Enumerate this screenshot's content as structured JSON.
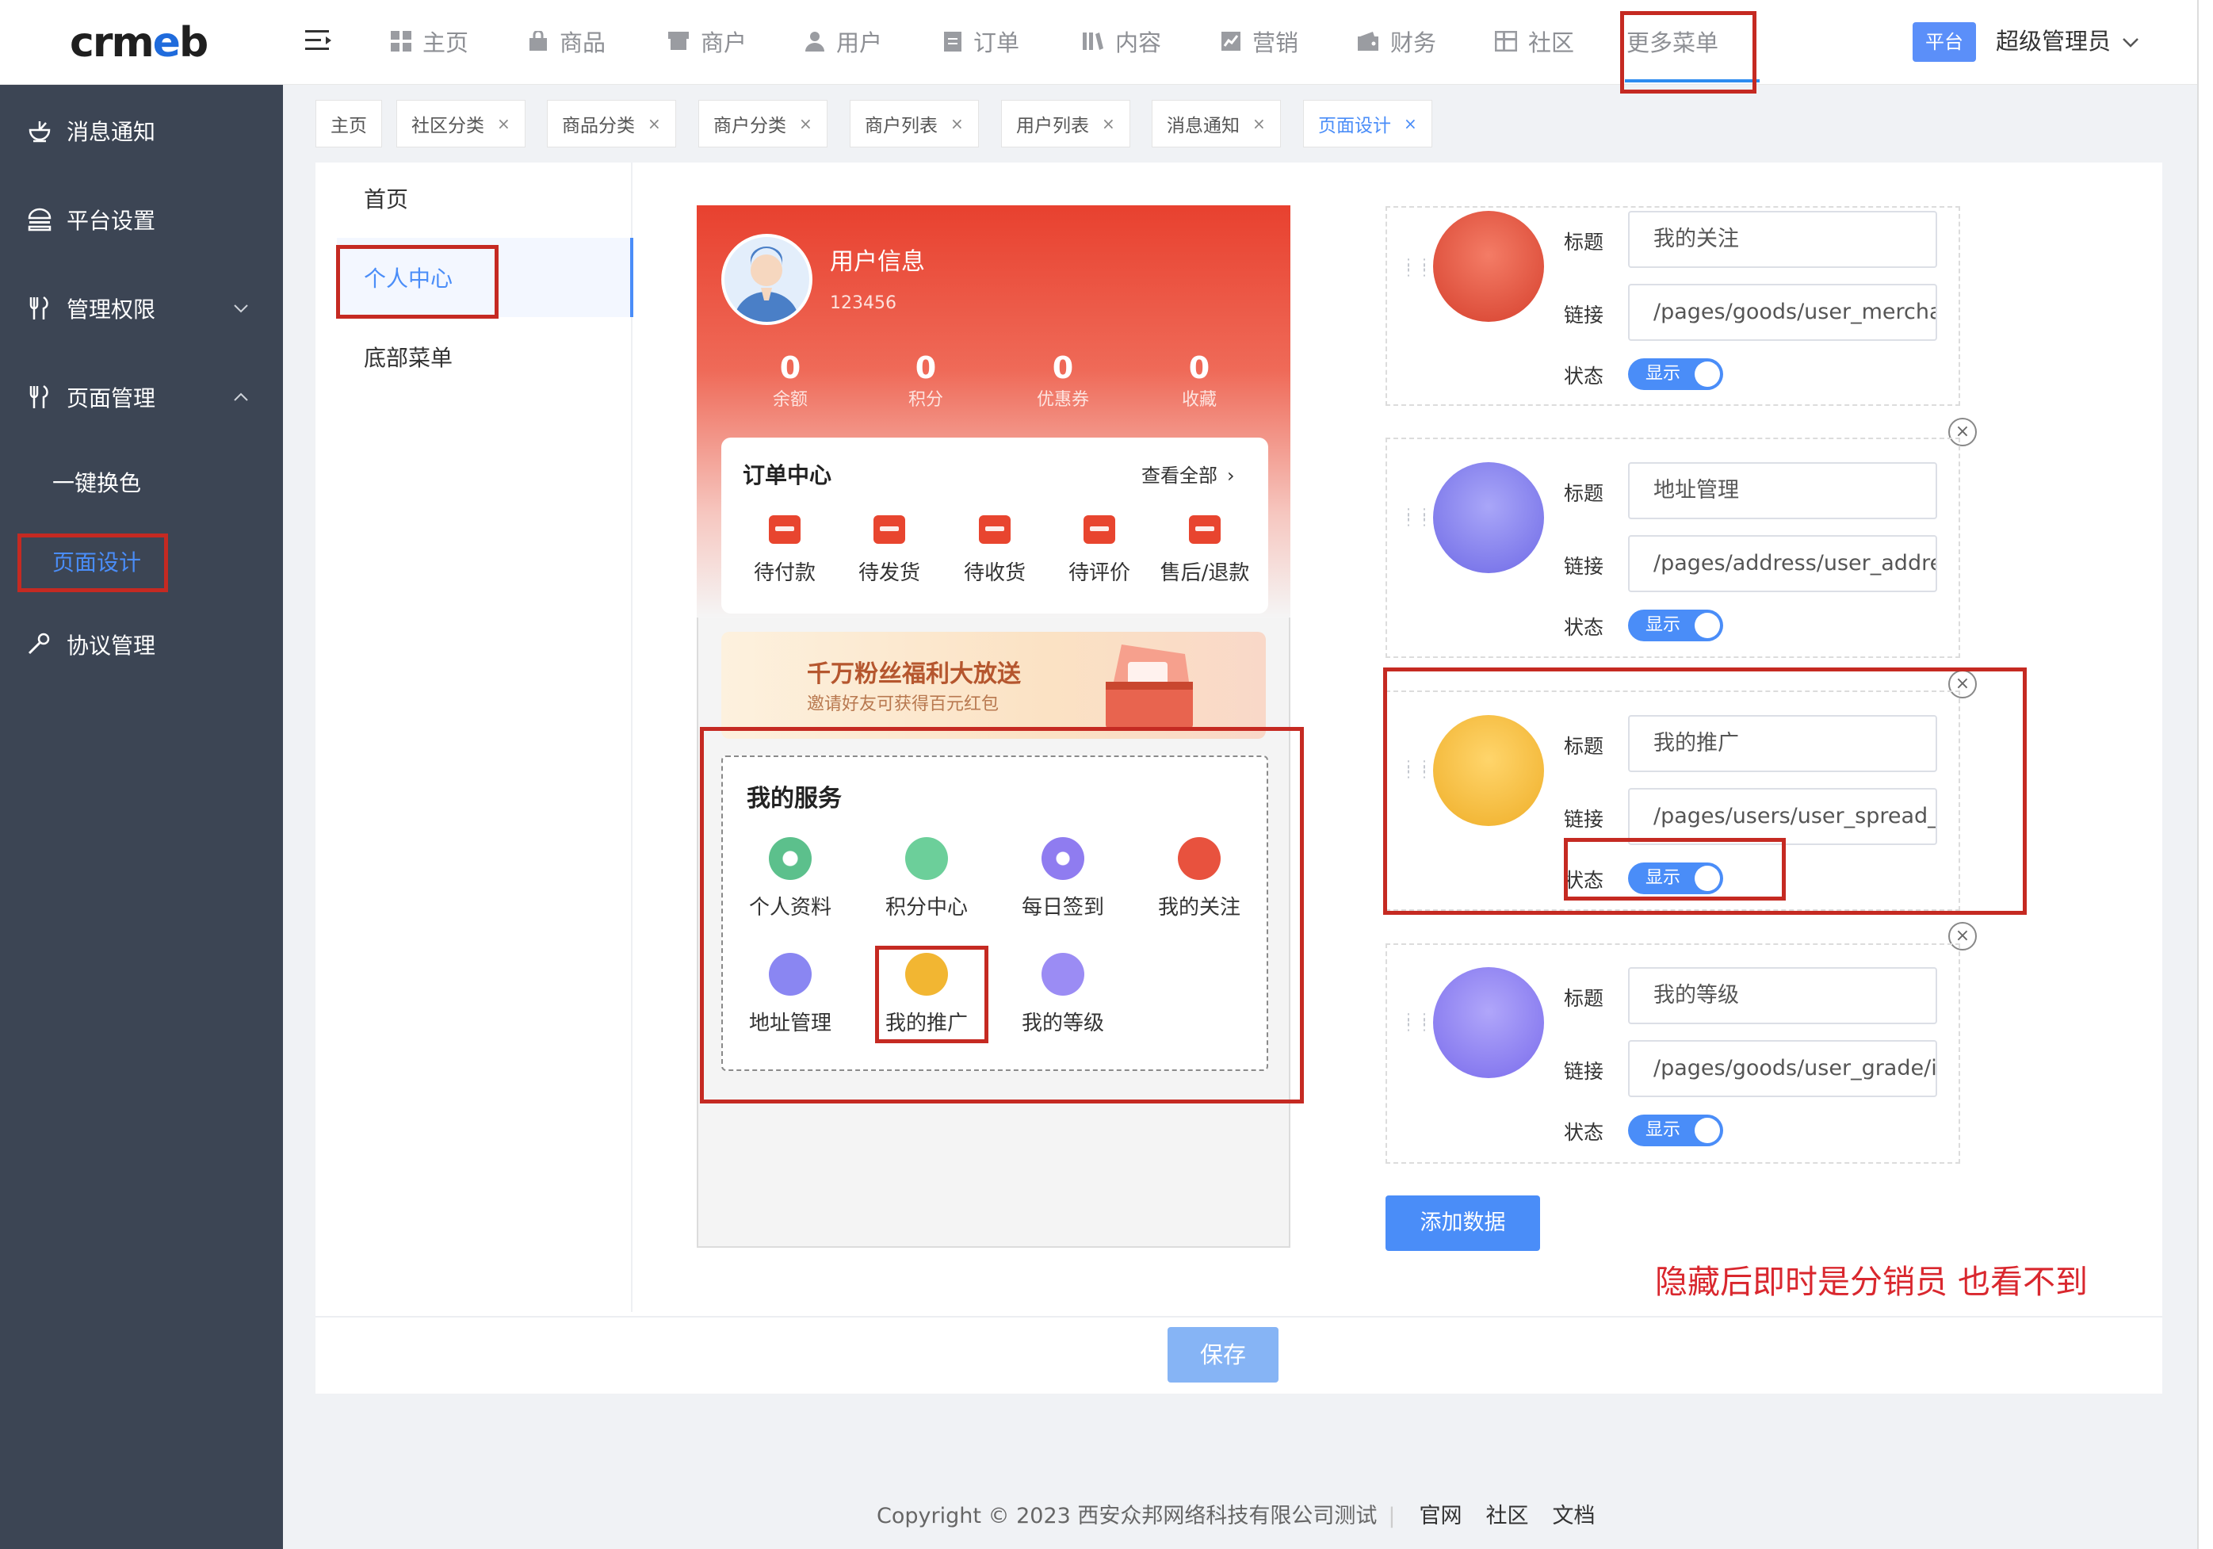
{
  "header": {
    "logo": "crmeb",
    "nav": [
      {
        "label": "主页",
        "icon": "grid-icon"
      },
      {
        "label": "商品",
        "icon": "bag-icon"
      },
      {
        "label": "商户",
        "icon": "shop-icon"
      },
      {
        "label": "用户",
        "icon": "user-icon"
      },
      {
        "label": "订单",
        "icon": "order-icon"
      },
      {
        "label": "内容",
        "icon": "content-icon"
      },
      {
        "label": "营销",
        "icon": "chart-icon"
      },
      {
        "label": "财务",
        "icon": "wallet-icon"
      },
      {
        "label": "社区",
        "icon": "community-icon"
      },
      {
        "label": "更多菜单",
        "icon": ""
      }
    ],
    "platform_badge": "平台",
    "admin_name": "超级管理员"
  },
  "sidebar": {
    "items": [
      {
        "label": "消息通知",
        "icon": "bell-icon"
      },
      {
        "label": "平台设置",
        "icon": "settings-icon"
      },
      {
        "label": "管理权限",
        "icon": "permission-icon"
      },
      {
        "label": "页面管理",
        "icon": "page-icon"
      },
      {
        "label": "协议管理",
        "icon": "wrench-icon"
      }
    ],
    "subitems": [
      {
        "label": "一键换色"
      },
      {
        "label": "页面设计"
      }
    ]
  },
  "tabs": [
    {
      "label": "主页"
    },
    {
      "label": "社区分类"
    },
    {
      "label": "商品分类"
    },
    {
      "label": "商户分类"
    },
    {
      "label": "商户列表"
    },
    {
      "label": "用户列表"
    },
    {
      "label": "消息通知"
    },
    {
      "label": "页面设计"
    }
  ],
  "page_nav": [
    {
      "label": "首页"
    },
    {
      "label": "个人中心"
    },
    {
      "label": "底部菜单"
    }
  ],
  "preview": {
    "user_title": "用户信息",
    "user_id": "123456",
    "stats": [
      {
        "v": "0",
        "k": "余额"
      },
      {
        "v": "0",
        "k": "积分"
      },
      {
        "v": "0",
        "k": "优惠券"
      },
      {
        "v": "0",
        "k": "收藏"
      }
    ],
    "order_title": "订单中心",
    "order_all": "查看全部",
    "orders": [
      {
        "label": "待付款"
      },
      {
        "label": "待发货"
      },
      {
        "label": "待收货"
      },
      {
        "label": "待评价"
      },
      {
        "label": "售后/退款"
      }
    ],
    "banner_title": "千万粉丝福利大放送",
    "banner_sub": "邀请好友可获得百元红包",
    "services_title": "我的服务",
    "services": [
      {
        "label": "个人资料",
        "color": "#5cc08c"
      },
      {
        "label": "积分中心",
        "color": "#6ccf9a"
      },
      {
        "label": "每日签到",
        "color": "#8f7cf0"
      },
      {
        "label": "我的关注",
        "color": "#e8523e"
      },
      {
        "label": "地址管理",
        "color": "#8a86f2"
      },
      {
        "label": "我的推广",
        "color": "#f2b632"
      },
      {
        "label": "我的等级",
        "color": "#9b8cf4"
      }
    ]
  },
  "form": {
    "title_label": "标题",
    "link_label": "链接",
    "status_label": "状态",
    "toggle_label": "显示",
    "rows": [
      {
        "title": "我的关注",
        "link": "/pages/goods/user_merchant_collect/index",
        "color": "#e8523e"
      },
      {
        "title": "地址管理",
        "link": "/pages/address/user_address_list/index",
        "color": "#8a86f2"
      },
      {
        "title": "我的推广",
        "link": "/pages/users/user_spread_user/index",
        "color": "#f2b632"
      },
      {
        "title": "我的等级",
        "link": "/pages/goods/user_grade/index",
        "color": "#8f86f2"
      }
    ],
    "add_button": "添加数据",
    "note": "隐藏后即时是分销员 也看不到",
    "save_button": "保存"
  },
  "footer": {
    "copyright": "Copyright © 2023 西安众邦网络科技有限公司测试",
    "links": [
      "官网",
      "社区",
      "文档"
    ]
  },
  "colors": {
    "accent": "#4a8df8",
    "sidebar": "#3c4554",
    "annotation": "#c52a22"
  }
}
